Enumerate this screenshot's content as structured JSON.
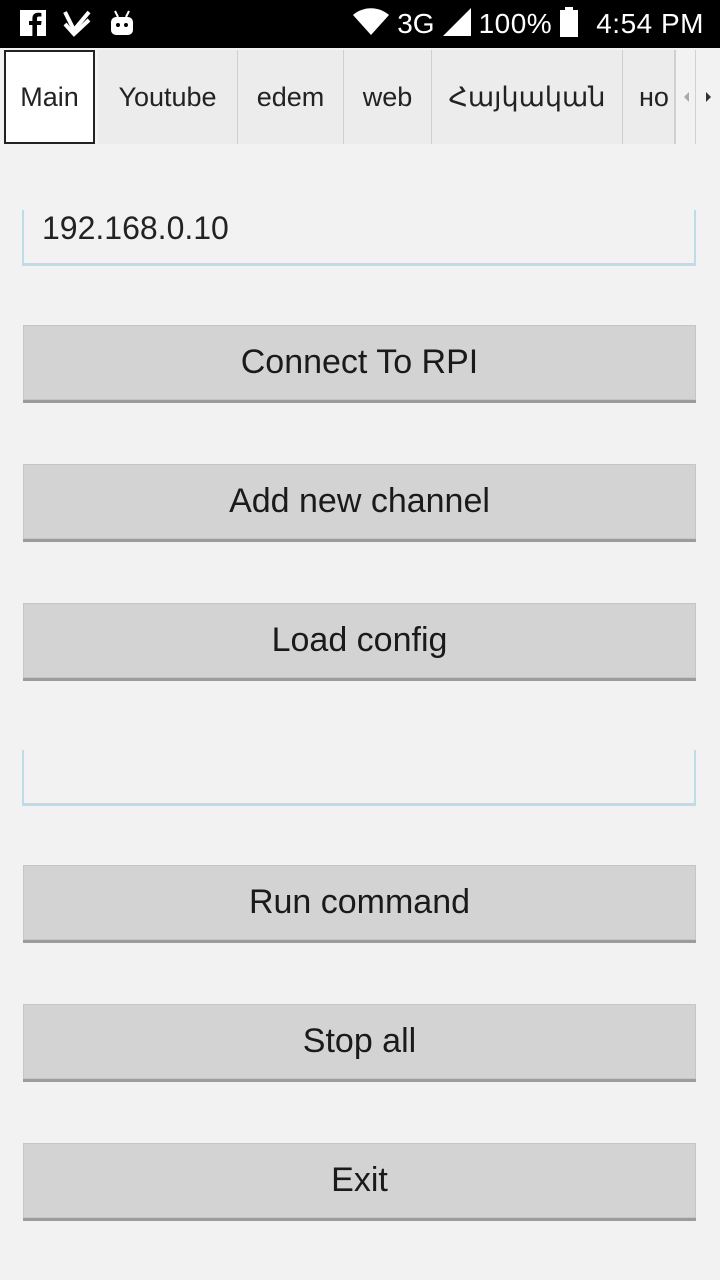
{
  "status_bar": {
    "network": "3G",
    "battery": "100%",
    "time": "4:54 PM",
    "icons": [
      "facebook-icon",
      "checkmark-notify-icon",
      "android-icon",
      "wifi-icon",
      "signal-icon",
      "battery-icon"
    ]
  },
  "tabs": [
    {
      "label": "Main",
      "active": true
    },
    {
      "label": "Youtube"
    },
    {
      "label": "edem"
    },
    {
      "label": "web"
    },
    {
      "label": "Հայկական"
    },
    {
      "label": "но"
    }
  ],
  "main": {
    "ip_field": {
      "value": "192.168.0.10",
      "placeholder": ""
    },
    "command_field": {
      "value": "",
      "placeholder": ""
    },
    "buttons": {
      "connect": "Connect To RPI",
      "add_channel": "Add new channel",
      "load_config": "Load config",
      "run_command": "Run command",
      "stop_all": "Stop all",
      "exit": "Exit"
    }
  },
  "colors": {
    "background": "#f2f2f2",
    "button": "#d3d3d3",
    "field_underline": "#bcdcea",
    "status_bar": "#000000"
  }
}
